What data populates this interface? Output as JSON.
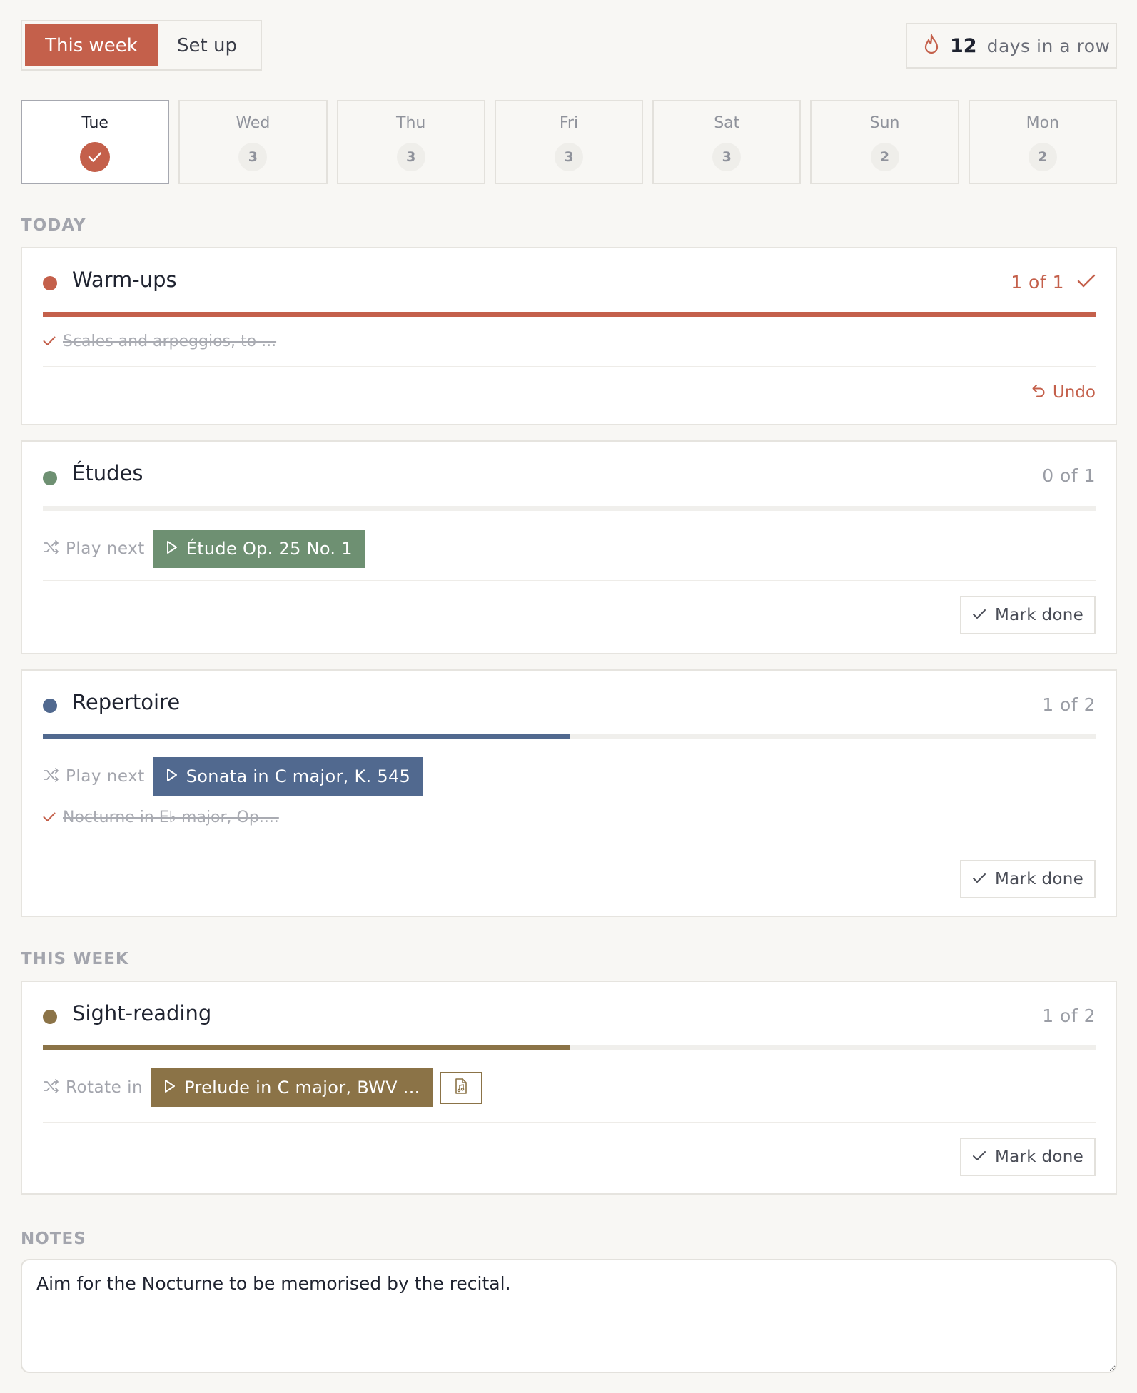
{
  "tabs": {
    "this_week": "This week",
    "set_up": "Set up"
  },
  "streak": {
    "count": "12",
    "label": "days in a row"
  },
  "days": [
    {
      "name": "Tue",
      "done": true
    },
    {
      "name": "Wed",
      "count": "3"
    },
    {
      "name": "Thu",
      "count": "3"
    },
    {
      "name": "Fri",
      "count": "3"
    },
    {
      "name": "Sat",
      "count": "3"
    },
    {
      "name": "Sun",
      "count": "2"
    },
    {
      "name": "Mon",
      "count": "2"
    }
  ],
  "sections": {
    "today": "TODAY",
    "this_week": "THIS WEEK",
    "notes": "NOTES"
  },
  "colors": {
    "warmups": "#c4604b",
    "etudes": "#6e9072",
    "repertoire": "#51698f",
    "sight_reading": "#8b7347"
  },
  "warmups": {
    "title": "Warm-ups",
    "count": "1 of 1",
    "progress": 1.0,
    "done_item": "Scales and arpeggios, to ...",
    "undo": "Undo"
  },
  "etudes": {
    "title": "Études",
    "count": "0 of 1",
    "progress": 0.0,
    "play_label": "Play next",
    "piece": "Étude Op. 25 No. 1",
    "mark_done": "Mark done"
  },
  "repertoire": {
    "title": "Repertoire",
    "count": "1 of 2",
    "progress": 0.5,
    "play_label": "Play next",
    "piece": "Sonata in C major, K. 545",
    "done_item": "Nocturne in E♭ major, Op....",
    "mark_done": "Mark done"
  },
  "sight_reading": {
    "title": "Sight-reading",
    "count": "1 of 2",
    "progress": 0.5,
    "play_label": "Rotate in",
    "piece": "Prelude in C major, BWV ...",
    "mark_done": "Mark done"
  },
  "notes": {
    "value": "Aim for the Nocturne to be memorised by the recital."
  }
}
